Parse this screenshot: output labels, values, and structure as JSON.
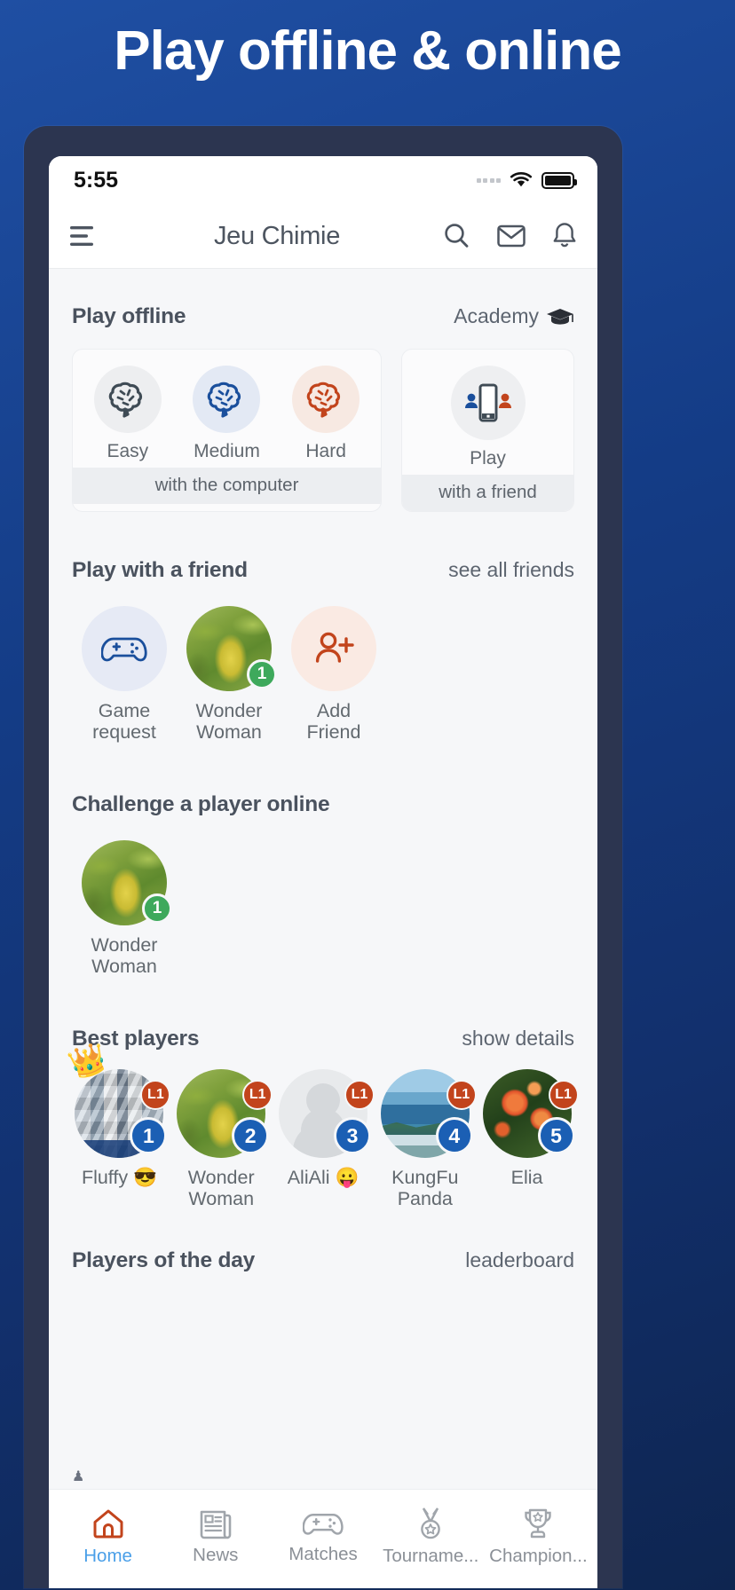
{
  "promo": {
    "headline": "Play offline & online"
  },
  "status_bar": {
    "time": "5:55",
    "wifi_icon": "wifi-icon",
    "battery_icon": "battery-full-icon",
    "signal_icon": "signal-dots-icon"
  },
  "app_bar": {
    "menu_icon": "hamburger-menu-icon",
    "title": "Jeu Chimie",
    "actions": [
      {
        "name": "search-icon",
        "label": "Search"
      },
      {
        "name": "mail-icon",
        "label": "Messages"
      },
      {
        "name": "bell-icon",
        "label": "Notifications"
      }
    ]
  },
  "play_offline": {
    "title": "Play offline",
    "link": "Academy",
    "link_icon": "graduation-cap-icon",
    "computer_card": {
      "footer": "with the computer",
      "modes": [
        {
          "label": "Easy",
          "icon": "brain-icon",
          "color": "#3f4b55",
          "bubble": "#edeef0"
        },
        {
          "label": "Medium",
          "icon": "brain-icon",
          "color": "#1a4f9c",
          "bubble": "#e3e9f4"
        },
        {
          "label": "Hard",
          "icon": "brain-icon",
          "color": "#c2441c",
          "bubble": "#f7e9e2"
        }
      ]
    },
    "friend_card": {
      "footer": "with a friend",
      "modes": [
        {
          "label": "Play",
          "icon": "two-players-phone-icon",
          "color": "#3f4b55",
          "bubble": "#eeeff1"
        }
      ]
    }
  },
  "play_with_friend": {
    "title": "Play with a friend",
    "link": "see all friends",
    "items": [
      {
        "label": "Game\nrequest",
        "label_line1": "Game",
        "label_line2": "request",
        "icon": "gamepad-icon",
        "avatar": "icon-gamepad",
        "bubble": "#e6eaf5",
        "color": "#1a4f9c",
        "badge": null
      },
      {
        "label": "Wonder Woman",
        "label_line1": "Wonder",
        "label_line2": "Woman",
        "icon": "avatar-photo",
        "avatar": "photo-leaves",
        "badge": "1"
      },
      {
        "label": "Add Friend",
        "label_line1": "Add",
        "label_line2": "Friend",
        "icon": "add-person-icon",
        "avatar": "icon-add-person",
        "bubble": "#faeae3",
        "color": "#c2441c",
        "badge": null
      }
    ]
  },
  "challenge_online": {
    "title": "Challenge a player online",
    "items": [
      {
        "label_line1": "Wonder",
        "label_line2": "Woman",
        "avatar": "photo-leaves",
        "badge": "1"
      }
    ]
  },
  "best_players": {
    "title": "Best players",
    "link": "show details",
    "players": [
      {
        "name": "Fluffy 😎",
        "avatar": "photo-collage",
        "level": "L1",
        "rank": "1",
        "crown": true,
        "line1": "Fluffy 😎",
        "line2": ""
      },
      {
        "name": "Wonder Woman",
        "avatar": "photo-leaves",
        "level": "L1",
        "rank": "2",
        "crown": false,
        "line1": "Wonder",
        "line2": "Woman"
      },
      {
        "name": "AliAli 😛",
        "avatar": "photo-person",
        "level": "L1",
        "rank": "3",
        "crown": false,
        "line1": "AliAli 😛",
        "line2": ""
      },
      {
        "name": "KungFu Panda",
        "avatar": "photo-sea",
        "level": "L1",
        "rank": "4",
        "crown": false,
        "line1": "KungFu",
        "line2": "Panda"
      },
      {
        "name": "Elia",
        "avatar": "photo-flower",
        "level": "L1",
        "rank": "5",
        "crown": false,
        "line1": "Elia",
        "line2": ""
      }
    ]
  },
  "players_of_day": {
    "title": "Players of the day",
    "link": "leaderboard"
  },
  "bottom_nav": {
    "items": [
      {
        "label": "Home",
        "icon": "home-icon",
        "active": true
      },
      {
        "label": "News",
        "icon": "newspaper-icon",
        "active": false
      },
      {
        "label": "Matches",
        "icon": "gamepad-icon",
        "active": false
      },
      {
        "label": "Tourname...",
        "icon": "medal-icon",
        "active": false
      },
      {
        "label": "Champion...",
        "icon": "trophy-icon",
        "active": false
      }
    ]
  },
  "colors": {
    "brand_blue": "#1a4f9c",
    "accent_orange": "#c2441c",
    "active_nav": "#4a9fe8",
    "rank_blue": "#1b5fb4",
    "online_green": "#3ea95c",
    "bg": "#f6f7f9"
  }
}
